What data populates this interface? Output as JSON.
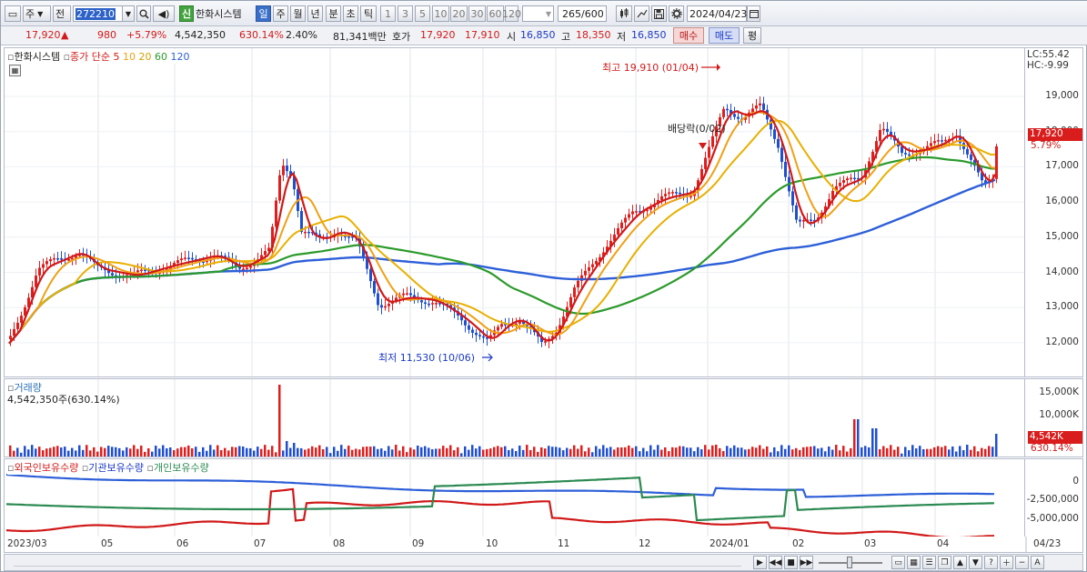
{
  "toolbar": {
    "market_type": "주",
    "market_scope": "전",
    "stock_code": "272210",
    "credit_badge": "신",
    "stock_name": "한화시스템",
    "periods": [
      "일",
      "주",
      "월",
      "년",
      "분",
      "초",
      "틱"
    ],
    "active_period": "일",
    "intervals": [
      "1",
      "3",
      "5",
      "10",
      "20",
      "30",
      "60",
      "120"
    ],
    "count_value": "265",
    "count_total": "/600",
    "date": "2024/04/23"
  },
  "quote": {
    "price": "17,920",
    "change_arrow": "▲",
    "change": "980",
    "change_pct": "+5.79%",
    "volume": "4,542,350",
    "volume_ratio": "630.14%",
    "turnover": "2.40%",
    "amount": "81,341백만",
    "bid_label": "호가",
    "ask_price": "17,920",
    "bid_price": "17,910",
    "open_label": "시",
    "open": "16,850",
    "high_label": "고",
    "high": "18,350",
    "low_label": "저",
    "low": "16,850",
    "buy_button": "매수",
    "sell_button": "매도",
    "eval_button": "평"
  },
  "price_panel": {
    "stock_label": "한화시스템",
    "legend_prefix": "종가 단순",
    "ma_periods": [
      "5",
      "10",
      "20",
      "60",
      "120"
    ],
    "ma_colors": [
      "#d11919",
      "#f0a015",
      "#e8b000",
      "#2b9a2b",
      "#2d5fd8"
    ],
    "lc_label": "LC:55.42",
    "hc_label": "HC:-9.99",
    "high_annotation": "최고 19,910 (01/04)",
    "low_annotation": "최저 11,530 (10/06)",
    "dividend_annotation": "배당락(0/02)",
    "current_tag": "17,920",
    "current_pct": "5.79%",
    "y_ticks": [
      "19,000",
      "18,000",
      "17,000",
      "16,000",
      "15,000",
      "14,000",
      "13,000",
      "12,000"
    ]
  },
  "volume_panel": {
    "title": "거래량",
    "value": "4,542,350주(630.14%)",
    "y_ticks": [
      "15,000K",
      "10,000K",
      "5,000K"
    ],
    "current_tag": "4,542K",
    "current_pct": "630.14%"
  },
  "holdings_panel": {
    "legend": [
      "외국인보유수량",
      "기관보유수량",
      "개인보유수량"
    ],
    "colors": [
      "#d11919",
      "#2d5fd8",
      "#2b8a52"
    ],
    "y_ticks": [
      "0",
      "-2,500,000",
      "-5,000,000"
    ]
  },
  "x_axis": {
    "labels": [
      "2023/03",
      "05",
      "06",
      "07",
      "08",
      "09",
      "10",
      "11",
      "12",
      "2024/01",
      "02",
      "03",
      "04",
      "04/23"
    ]
  },
  "scrollbar": {
    "controls": [
      "▶",
      "◀◀",
      "■",
      "▶▶",
      "▲",
      "▼",
      "?",
      "＋",
      "−",
      "A"
    ]
  }
}
